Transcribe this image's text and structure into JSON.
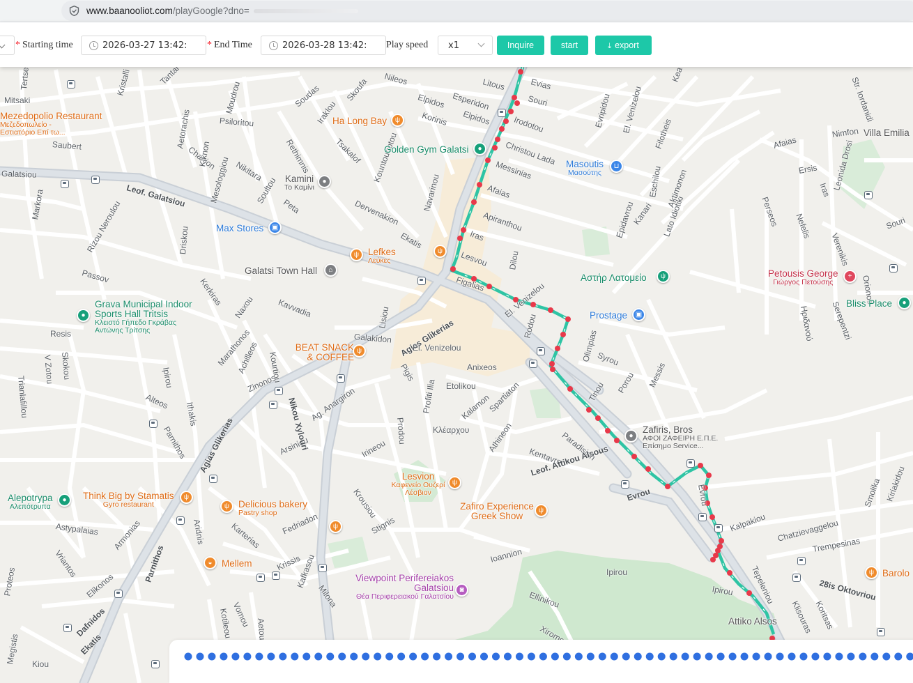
{
  "browser": {
    "url_host": "www.baanooliot.com",
    "url_path": "/playGoogle?dno="
  },
  "query": {
    "starting_time_label": "Starting time",
    "starting_time_value": "2026-03-27 13:42:",
    "end_time_label": "End Time",
    "end_time_value": "2026-03-28 13:42:",
    "play_speed_label": "Play speed",
    "play_speed_value": "x1",
    "inquire_label": "Inquire",
    "start_label": "start",
    "export_label": "export"
  },
  "playback": {
    "total_points": 80,
    "current_index": 62
  },
  "map": {
    "places": [
      {
        "name": "Mezedopolio Restaurant",
        "sub": "Μεζεδοπωλείο - Εστιατόριο Επί τω...",
        "color": "o"
      },
      {
        "name": "Ha Long Bay",
        "color": "o"
      },
      {
        "name": "Golden Gym Galatsi",
        "color": "t"
      },
      {
        "name": "Kamini",
        "sub": "Το Καμίνι",
        "color": "g"
      },
      {
        "name": "Masoutis",
        "sub": "Μασούτης",
        "color": "b"
      },
      {
        "name": "Max Stores",
        "color": "b"
      },
      {
        "name": "Lefkes",
        "sub": "Λεύκες",
        "color": "o"
      },
      {
        "name": "Galatsi Town Hall",
        "color": "g"
      },
      {
        "name": "Αστήρ Λατομείο",
        "color": "t"
      },
      {
        "name": "Petousis George",
        "sub": "Γιώργος Πετούσης",
        "color": "r"
      },
      {
        "name": "Bliss Place",
        "color": "t"
      },
      {
        "name": "Grava Municipal Indoor Sports Hall Tritsis",
        "sub": "Κλειστό Γήπεδο Γκράβας Αντώνης Τρίτσης",
        "color": "t"
      },
      {
        "name": "Prostage",
        "color": "b"
      },
      {
        "name": "BEAT SNACK & COFFEE",
        "color": "o"
      },
      {
        "name": "Zafiris, Bros",
        "sub": "ΑΦΟΙ ΖΑΦΕΙΡΗ Ε.Π.Ε. Επίσημο Service...",
        "color": "g"
      },
      {
        "name": "Lesvion",
        "sub": "Καφενείο Ουζερί Λέσβιον",
        "color": "o"
      },
      {
        "name": "Alepotrypa",
        "sub": "Αλεπότρυπα",
        "color": "t"
      },
      {
        "name": "Think Big by Stamatis",
        "sub": "Gyro restaurant",
        "color": "o"
      },
      {
        "name": "Delicious bakery",
        "sub": "Pastry shop",
        "color": "o"
      },
      {
        "name": "Zafiro Experience Greek Show",
        "color": "o"
      },
      {
        "name": "Mellem",
        "color": "o"
      },
      {
        "name": "Viewpoint Perifereiakos Galatsiou",
        "sub": "Θέα Περιφερειακού Γαλατσίου",
        "color": "p"
      },
      {
        "name": "Barolo",
        "color": "o"
      },
      {
        "name": "Villa Emilia",
        "color": "g"
      },
      {
        "name": "Attiko Alsos",
        "color": "g"
      }
    ],
    "streets": [
      "Mitsaki",
      "Tertseti",
      "Kristalli",
      "Tantal",
      "Nileos",
      "Moudrou",
      "Soudas",
      "Iraklou",
      "Skoufa",
      "Litous",
      "Esperidon",
      "Elpidos",
      "Korinis",
      "Elpidos",
      "Irodotou",
      "Evias",
      "Souri",
      "Psiloritou",
      "Saubert",
      "Chanion",
      "Rethimnis",
      "Tsakalof",
      "Christou Lada",
      "Messinias",
      "Afaias",
      "Apiranthou",
      "Iras",
      "Lesvou",
      "Galatsiou",
      "Leof. Galatsiou",
      "Aetorachis",
      "Kiknon",
      "Mesologgiou",
      "Nikitara",
      "Soultou",
      "Peta",
      "Kountouriotou",
      "Navarinou",
      "Dervenakion",
      "Ekatis",
      "Markora",
      "Rizou Neroulou",
      "Driskou",
      "Passov",
      "Kerkiras",
      "Naxou",
      "Kavvadia",
      "Lisiou",
      "Galakidon",
      "Agias Glikerias",
      "El. Venizelou",
      "Figalias",
      "Dilou",
      "El. Venizelou",
      "Olimpias",
      "Syrou",
      "Tinou",
      "Porou",
      "Messis",
      "Rodou",
      "Resis",
      "Trianlafillou",
      "V Zotou",
      "Skokou",
      "Marathonos",
      "Achilleos",
      "Kourtiou",
      "Zinonos",
      "Ag. Anargiron",
      "Anixeos",
      "Etolikou",
      "Pigis",
      "Profiti Ilia",
      "Prodou",
      "Kalamon",
      "Spartiaton",
      "Κλέαρχου",
      "Athineon",
      "Kentavron",
      "Paradision",
      "Leof. Attikou Alsous",
      "Evrou",
      "Evrou",
      "Kalpakiou",
      "Chatzievaggelou",
      "Trempesinas",
      "Tepeleniou",
      "28is Oktovriou",
      "Koritsas",
      "Klisouras",
      "Ipirou",
      "Ipirou",
      "Ellinikou",
      "Xiromer",
      "Ioannion",
      "Stignis",
      "Fedriadon",
      "Karterias",
      "Krissis",
      "Kafkasou",
      "Milona",
      "Irineou",
      "Krousiou",
      "Arsiniou",
      "Nikou Xylouri",
      "Ithakis",
      "Ipirou",
      "Alteos",
      "Parnithos",
      "Agias Glikerias",
      "Aridnis",
      "Parnithos",
      "Astypalaias",
      "Armonias",
      "Elikonos",
      "Vriantos",
      "Proteos",
      "Dafnidos",
      "Ekatis",
      "Megistis",
      "Kiou",
      "Kotileou",
      "Vomou",
      "Aetou",
      "Afaias",
      "Ersis",
      "Nimfon",
      "Leonida Drosi",
      "Perseos",
      "Nefelis",
      "Iras",
      "Verenikis",
      "Souri",
      "Orionos",
      "Serepentzi",
      "Ηριδανού",
      "Str. Iordanidi",
      "Filotheis",
      "Aktimonon",
      "Lato Idiotiki",
      "Eschilou",
      "Kanari",
      "Epidavrou",
      "Evripidou",
      "El. Venizelou",
      "Kea",
      "Smolika",
      "Kiriakidou"
    ]
  }
}
